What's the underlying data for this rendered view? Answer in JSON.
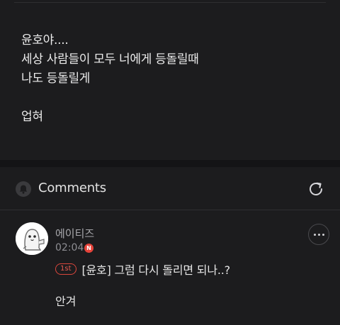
{
  "post": {
    "lines": [
      "윤호야....",
      "세상 사람들이 모두 너에게 등돌릴때",
      "나도 등돌릴게",
      "",
      "업혀"
    ]
  },
  "comments_section": {
    "title": "Comments",
    "bell_icon": "bell-icon",
    "refresh_icon": "refresh-icon"
  },
  "comment": {
    "author": "에이티즈",
    "time": "02:04",
    "new_badge": "N",
    "rank_badge": "1st",
    "reply_text": "[윤호] 그럼 다시 돌리면 되나..?",
    "body": "안겨"
  },
  "colors": {
    "background": "#1c1c1e",
    "separator": "#141416",
    "accent_red": "#e6433a"
  }
}
